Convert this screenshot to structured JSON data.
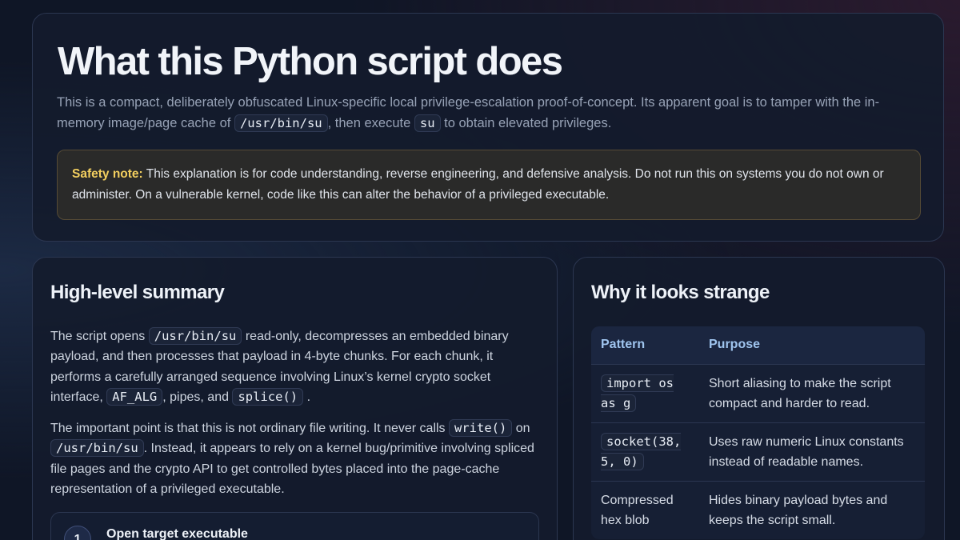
{
  "hero": {
    "title": "What this Python script does",
    "intro_1": "This is a compact, deliberately obfuscated Linux-specific local privilege-escalation proof-of-concept. Its apparent goal is to tamper with the in-memory image/page cache of",
    "intro_code_1": "/usr/bin/su",
    "intro_2": ", then execute",
    "intro_code_2": "su",
    "intro_3": "to obtain elevated privileges.",
    "note_label": "Safety note:",
    "note_text": "This explanation is for code understanding, reverse engineering, and defensive analysis. Do not run this on systems you do not own or administer. On a vulnerable kernel, code like this can alter the behavior of a privileged executable."
  },
  "summary": {
    "heading": "High-level summary",
    "p1_a": "The script opens",
    "p1_code_1": "/usr/bin/su",
    "p1_b": "read-only, decompresses an embedded binary payload, and then processes that payload in 4-byte chunks. For each chunk, it performs a carefully arranged sequence involving Linux’s kernel crypto socket interface,",
    "p1_code_2": "AF_ALG",
    "p1_c": ", pipes, and",
    "p1_code_3": "splice()",
    "p1_d": ".",
    "p2_a": "The important point is that this is not ordinary file writing. It never calls",
    "p2_code_1": "write()",
    "p2_b": "on",
    "p2_code_2": "/usr/bin/su",
    "p2_c": ". Instead, it appears to rely on a kernel bug/primitive involving spliced file pages and the crypto API to get controlled bytes placed into the page-cache representation of a privileged executable.",
    "step_number": "1",
    "step_title": "Open target executable"
  },
  "why": {
    "heading": "Why it looks strange",
    "col_pattern": "Pattern",
    "col_purpose": "Purpose",
    "rows": [
      {
        "pattern": "import os as g",
        "is_code": true,
        "purpose": "Short aliasing to make the script compact and harder to read."
      },
      {
        "pattern": "socket(38, 5, 0)",
        "is_code": true,
        "purpose": "Uses raw numeric Linux constants instead of readable names."
      },
      {
        "pattern": "Compressed hex blob",
        "is_code": false,
        "purpose": "Hides binary payload bytes and keeps the script small."
      }
    ]
  }
}
